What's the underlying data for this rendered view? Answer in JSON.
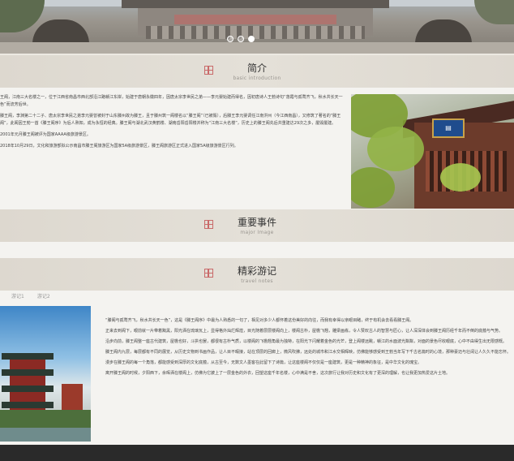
{
  "carousel": {
    "slide_count": 3,
    "active_index": 2
  },
  "sections": {
    "intro": {
      "title": "简介",
      "subtitle": "basic introduction"
    },
    "events": {
      "title": "重要事件",
      "subtitle": "major Image"
    },
    "travel": {
      "title": "精彩游记",
      "subtitle": "travel notes"
    }
  },
  "intro_paragraphs": [
    "王阁，江南三大名楼之一，位于江西省南昌市西北部沿江路赣江东岸，始建于唐朝永徽四年，因唐太宗李世民之弟——李元婴始建而得名，因初唐诗人王勃诗句“落霞与孤鹜齐飞，秋水共长天一色”而流芳后世。",
    "滕王阁，李渊第二十二子、唐太宗李世民之弟李元婴曾被封于山东滕州故为滕王，且于滕州筑一阁楼名以“滕王阁”（已被毁），后滕王李元婴调任江南洪州（今江西南昌），又修筑了著名的“滕王阁”，此阁因王勃一首《滕王阁序》为后人熟知，成为永恒的经典。滕王阁与湖北武汉黄鹤楼、湖南岳阳岳阳楼并称为“江南三大名楼”，历史上的滕王阁先后共重建达29次之多，屡毁屡建。",
    "2001年元月滕王阁被评为国家AAAA级旅游景区。",
    "2018年10月29日，文化和旅游部拟公示南昌市滕王阁旅游区为国家5A级旅游景区，滕王阁旅游区正式进入国家5A级旅游景区行列。"
  ],
  "tabs": [
    "游记1",
    "游记2"
  ],
  "travel_paragraphs": [
    "“滕阁与孤鹜齐飞，秋水共长天一色”，这是《滕王阁序》中最为人熟悉的一句了，相见对多少人都怀着这份美好的向往，而我有幸得以亲眼目睹，终于有机会去看看滕王阁。",
    "正来去到阁下，眼前就一片带着黝黑，阳光洒在琉璃瓦上，显得格外灿烂辉煌，目光随着层层楼阁向上，楼阁古朴，屋檐飞翘，雕梁画栋，令人赞叹古人的智慧与匠心，让人深深体会到滕王阁历经千年而不倒的底蕴与气势。",
    "沿步向前，滕王阁整一座古代建筑，屋檐也好，斗拱也罢，都很有古朴气质，以楼阁的飞檐翘角最为独特，在阳光下闪耀着金色的光芒，登上阁楼远眺，赣江的水面波光粼粼，对面的景色尽收眼底，心中不由得生出无限感慨。",
    "滕王阁内九层，每层都有不同的展览，从历史文物到书画作品，让人目不暇接，站在顶层的回廊上，微风吹拂，远处的城市和江水交相辉映，仿佛能够感受到王勃当年写下千古名篇时的心境，那种豪迈与壮阔让人久久不能忘怀。",
    "漫步在滕王阁的每一个角落，都能感受到深厚的文化底蕴，从古至今，无数文人墨客在此留下了诗篇，让这座楼阁不仅仅是一座建筑，更是一种精神的象征，是中华文化的瑰宝。",
    "离开滕王阁的时候，夕阳西下，余晖洒在楼阁上，仿佛为它披上了一层金色的外衣，回望这座千年名楼，心中满是不舍，这次旅行让我对历史和文化有了更深的理解，也让我更加热爱这片土地。"
  ]
}
